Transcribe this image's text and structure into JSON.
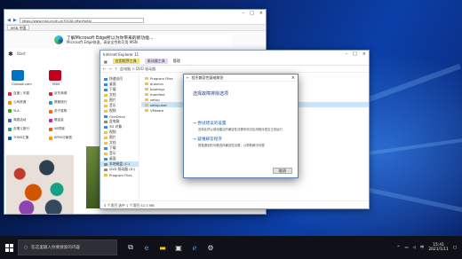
{
  "ie_window": {
    "title": "MSN 中国",
    "url": "https://www.msn.cn/zh-cn?OCID=MsnPortal",
    "tab_label": "MSN 中国",
    "edge_banner": {
      "title": "了解Microsoft Edge所以为你带来的新功能...",
      "subtitle": "Microsoft Edge快速，高安全性和可用 MSN"
    },
    "msn": {
      "logo": "msn",
      "start_label": "Start",
      "tiles": [
        "Outlook.com",
        "MSN"
      ],
      "links": [
        [
          "百度 | 天猫",
          "京东商城"
        ],
        [
          "公司资源",
          "携程旅行"
        ],
        [
          "YLA",
          "苏宁易购"
        ],
        [
          "商旅活动",
          "唯品会"
        ],
        [
          "去哪儿旅行",
          "58同城"
        ],
        [
          "TOMS汇集",
          "KFRS中家居"
        ]
      ]
    }
  },
  "explorer_window": {
    "title": "Internet Explorer 11",
    "ribbon": {
      "manage_tab": "应用程序工具",
      "manage_tab2": "驱动器工具",
      "manage_tab3": "管理"
    },
    "path": "此电脑 > DVD 驱动器",
    "nav_items": [
      "快速访问",
      "桌面",
      "下载",
      "文档",
      "图片",
      "音乐",
      "视频",
      "OneDrive",
      "此电脑",
      "3D 对象",
      "视频",
      "图片",
      "文档",
      "下载",
      "音乐",
      "桌面",
      "本地磁盘 (C:)",
      "DVD 驱动器 (D:)",
      "Program Files"
    ],
    "files": [
      "Program Files",
      "autorun",
      "bootmgr",
      "manifest",
      "setup",
      "setup.exe",
      "VMware"
    ],
    "status": "5 个项目    选中 1 个项目  52.5 MB"
  },
  "wizard": {
    "title": "程序兼容性疑难解答",
    "heading": "选择故障排除选项",
    "option1": "尝试建议的设置",
    "option1_desc": "选择此项以使用建议的兼容性设置来测试应用程序是否正常运行",
    "option2": "疑难解答程序",
    "option2_desc": "根据遇到的问题选择兼容性设置，以帮助解决问题",
    "cancel_label": "取消"
  },
  "taskbar": {
    "search_placeholder": "在这里输入你要搜索的内容",
    "time": "15:41",
    "date": "2021/1/11",
    "tray_lang": "中"
  }
}
